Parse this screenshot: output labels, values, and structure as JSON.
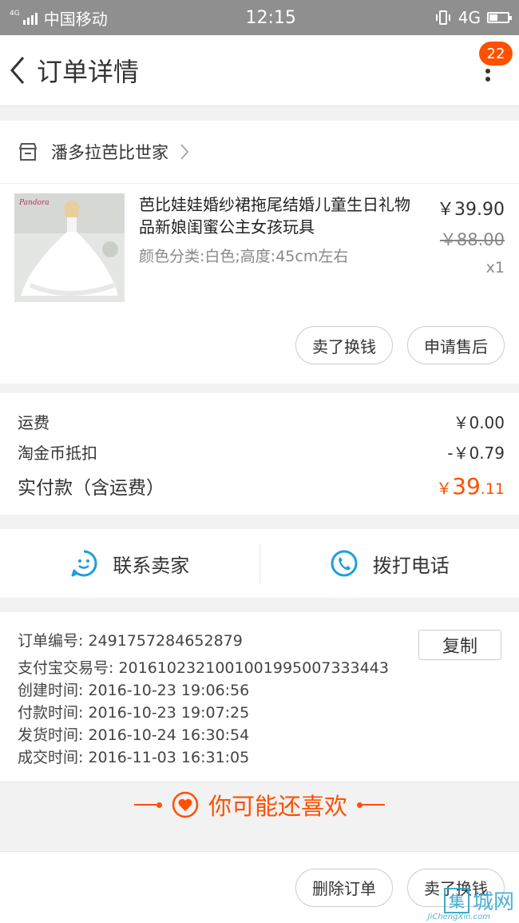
{
  "status_bar": {
    "network_tag": "4G",
    "carrier": "中国移动",
    "time": "12:15",
    "network": "4G"
  },
  "nav": {
    "title": "订单详情",
    "badge": "22"
  },
  "shop": {
    "name": "潘多拉芭比世家"
  },
  "product": {
    "title": "芭比娃娃婚纱裙拖尾结婚儿童生日礼物品新娘闺蜜公主女孩玩具",
    "sku": "颜色分类:白色;高度:45cm左右",
    "price_now": "￥39.90",
    "price_original": "￥88.00",
    "quantity": "x1",
    "thumb_logo": "Pandora"
  },
  "product_actions": {
    "sell_label": "卖了换钱",
    "after_sale_label": "申请售后"
  },
  "fees": {
    "shipping_label": "运费",
    "shipping_value": "￥0.00",
    "coin_label": "淘金币抵扣",
    "coin_value": "-￥0.79",
    "total_label": "实付款（含运费）",
    "total_currency": "￥",
    "total_integer": "39",
    "total_decimal": ".11"
  },
  "contact": {
    "seller_label": "联系卖家",
    "phone_label": "拨打电话"
  },
  "order_info": {
    "order_no": "订单编号:  2491757284652879",
    "alipay_no": "支付宝交易号:  2016102321001001995007333443",
    "created": "创建时间:  2016-10-23 19:06:56",
    "paid": "付款时间:  2016-10-23 19:07:25",
    "shipped": "发货时间:  2016-10-24 16:30:54",
    "completed": "成交时间:  2016-11-03 16:31:05",
    "copy_label": "复制"
  },
  "recommend": {
    "label": "你可能还喜欢"
  },
  "bottom_bar": {
    "delete_label": "删除订单",
    "sell_label": "卖了换钱"
  },
  "watermark": {
    "box_char": "集",
    "text": "城网",
    "sub": "JiChengXin.com"
  },
  "colors": {
    "accent": "#ff5000",
    "contact_icon": "#1f9ee0"
  }
}
